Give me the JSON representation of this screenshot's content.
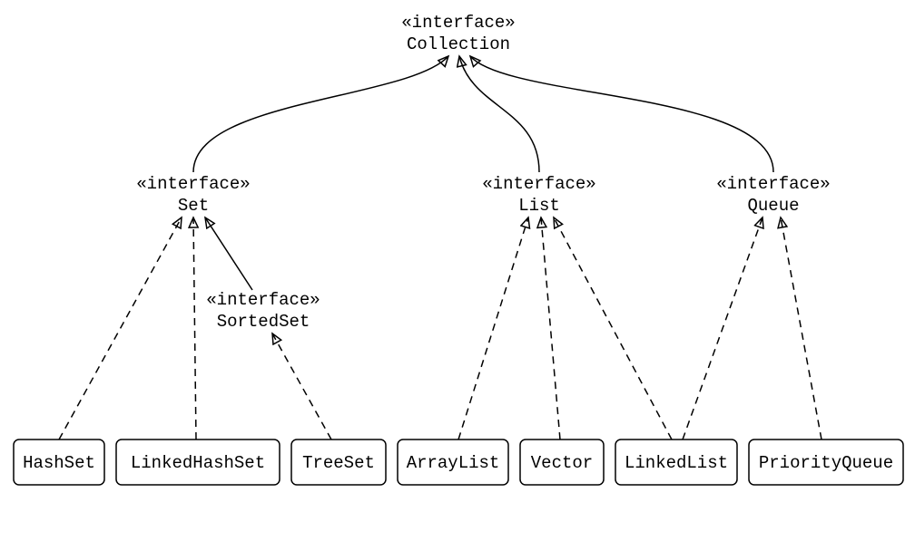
{
  "stereotype": "«interface»",
  "nodes": {
    "collection": "Collection",
    "set": "Set",
    "list": "List",
    "queue": "Queue",
    "sortedset": "SortedSet",
    "hashset": "HashSet",
    "linkedhashset": "LinkedHashSet",
    "treeset": "TreeSet",
    "arraylist": "ArrayList",
    "vector": "Vector",
    "linkedlist": "LinkedList",
    "priorityqueue": "PriorityQueue"
  }
}
